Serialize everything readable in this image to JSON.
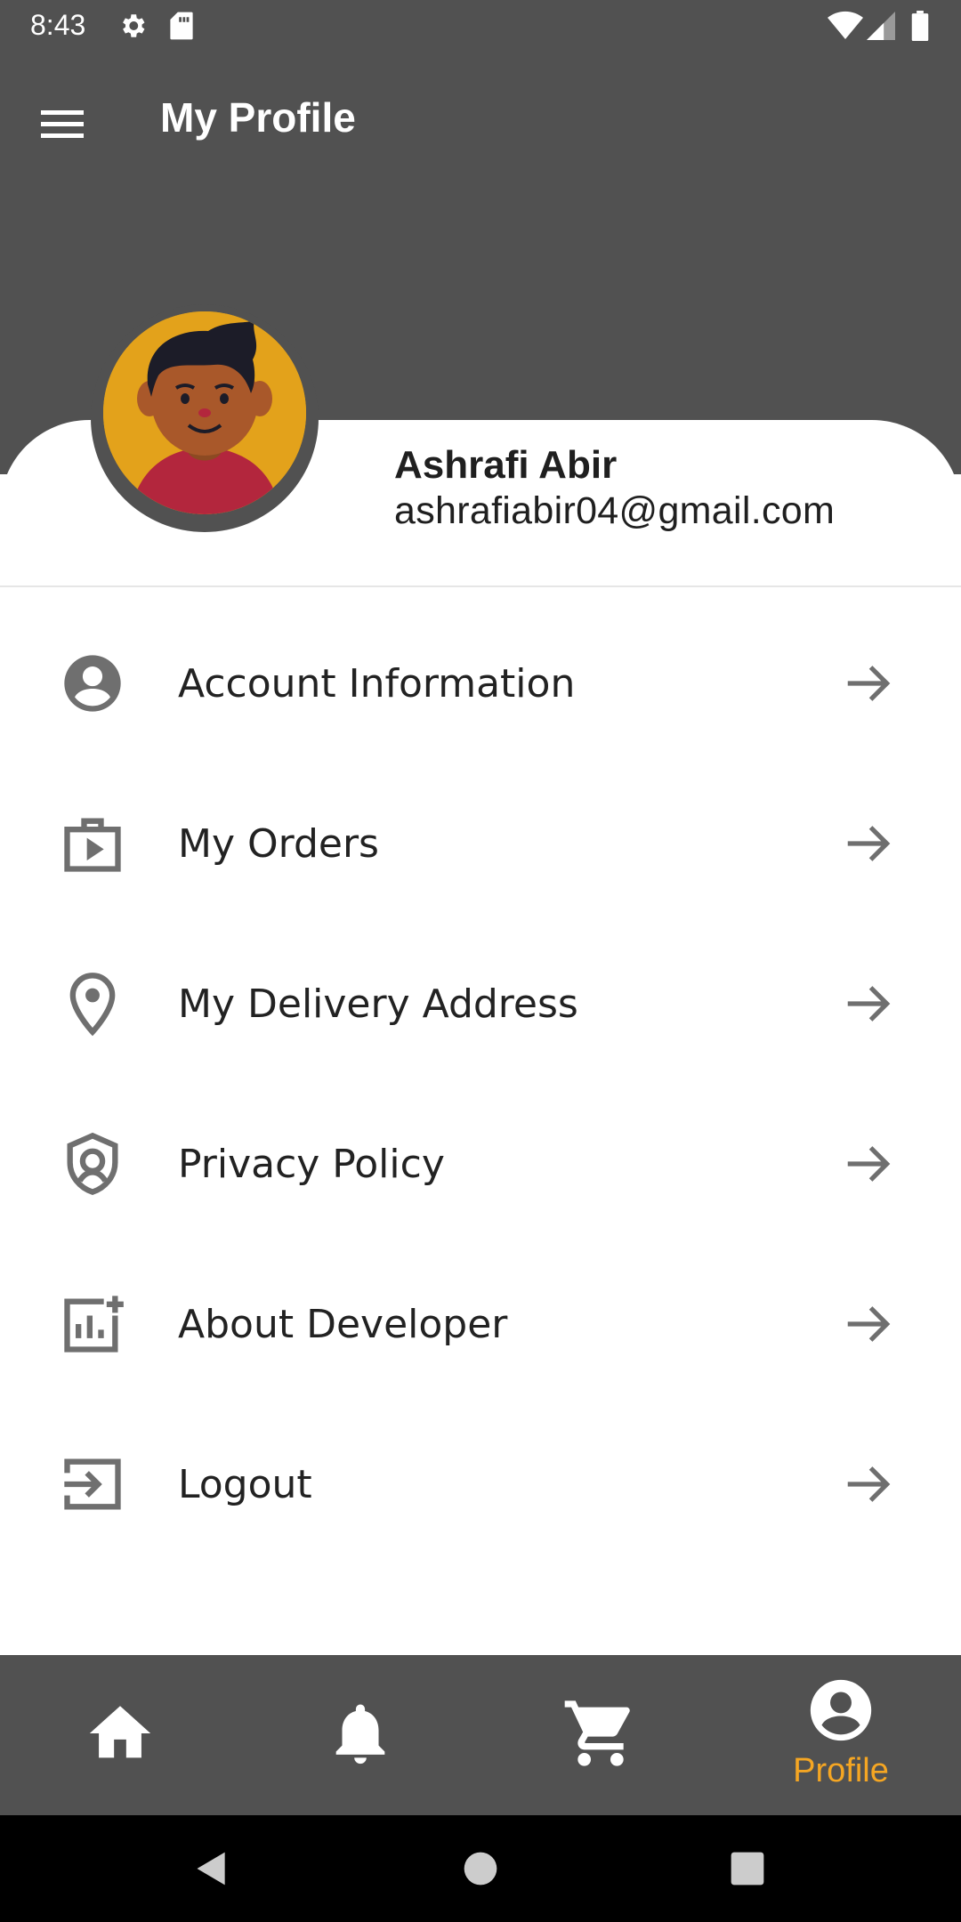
{
  "status_bar": {
    "time": "8:43",
    "icons": [
      "gear-icon",
      "sd-card-icon",
      "wifi-icon",
      "signal-icon",
      "battery-icon"
    ]
  },
  "app_bar": {
    "title": "My Profile",
    "menu_icon": "hamburger-menu-icon"
  },
  "profile": {
    "name": "Ashrafi Abir",
    "email": "ashrafiabir04@gmail.com"
  },
  "menu": {
    "items": [
      {
        "label": "Account Information",
        "icon": "account-circle-icon"
      },
      {
        "label": "My Orders",
        "icon": "shopping-bag-icon"
      },
      {
        "label": "My Delivery Address",
        "icon": "location-pin-icon"
      },
      {
        "label": "Privacy Policy",
        "icon": "shield-icon"
      },
      {
        "label": "About Developer",
        "icon": "analytics-add-icon"
      },
      {
        "label": "Logout",
        "icon": "logout-icon"
      }
    ],
    "arrow_icon": "arrow-right-icon"
  },
  "bottom_nav": {
    "items": [
      {
        "icon": "home-icon"
      },
      {
        "icon": "bell-icon"
      },
      {
        "icon": "cart-icon"
      },
      {
        "icon": "profile-icon",
        "label": "Profile",
        "active": true
      }
    ],
    "active_color": "#f5a623"
  },
  "colors": {
    "header_bg": "#515151",
    "accent": "#f5a623",
    "icon_gray": "#6f6f6f"
  }
}
